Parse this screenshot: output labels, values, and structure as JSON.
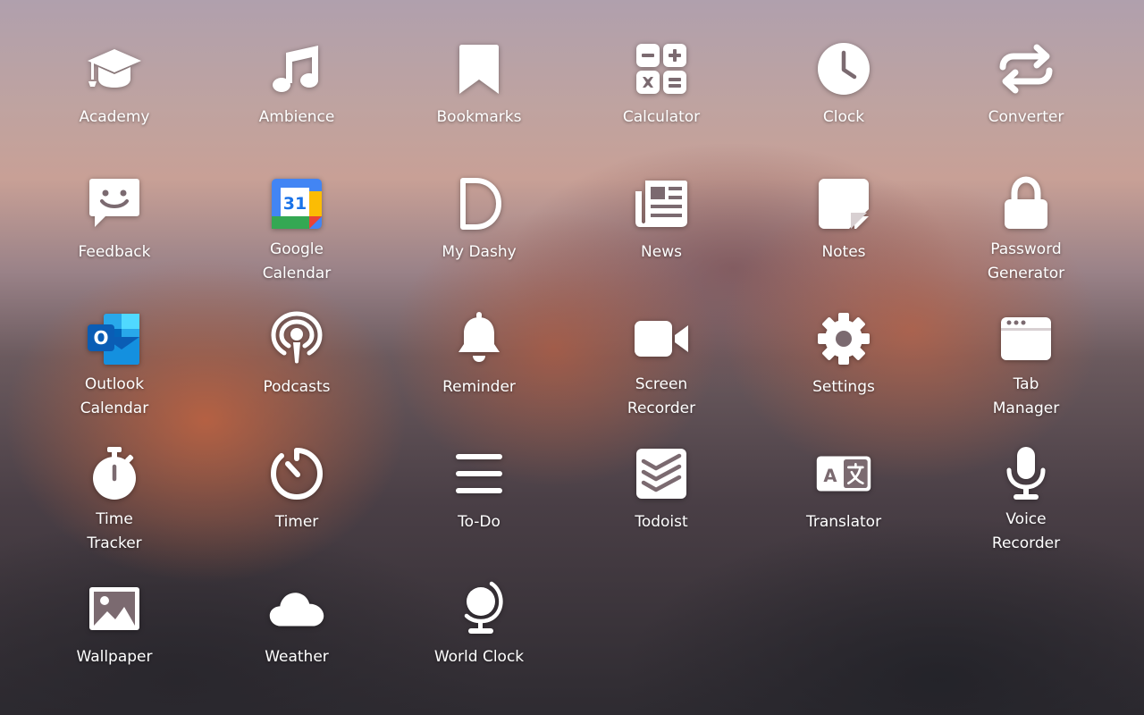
{
  "apps": [
    {
      "label": "Academy",
      "icon": "graduation-cap-icon"
    },
    {
      "label": "Ambience",
      "icon": "music-note-icon"
    },
    {
      "label": "Bookmarks",
      "icon": "bookmark-icon"
    },
    {
      "label": "Calculator",
      "icon": "calculator-icon"
    },
    {
      "label": "Clock",
      "icon": "clock-icon"
    },
    {
      "label": "Converter",
      "icon": "swap-arrows-icon"
    },
    {
      "label": "Feedback",
      "icon": "smiley-chat-icon"
    },
    {
      "label": "Google\nCalendar",
      "icon": "google-calendar-icon",
      "badge_text": "31"
    },
    {
      "label": "My Dashy",
      "icon": "dashy-logo-icon"
    },
    {
      "label": "News",
      "icon": "newspaper-icon"
    },
    {
      "label": "Notes",
      "icon": "sticky-note-icon"
    },
    {
      "label": "Password\nGenerator",
      "icon": "padlock-icon"
    },
    {
      "label": "Outlook\nCalendar",
      "icon": "outlook-icon",
      "badge_text": "O"
    },
    {
      "label": "Podcasts",
      "icon": "podcast-icon"
    },
    {
      "label": "Reminder",
      "icon": "bell-icon"
    },
    {
      "label": "Screen\nRecorder",
      "icon": "video-camera-icon"
    },
    {
      "label": "Settings",
      "icon": "gear-icon"
    },
    {
      "label": "Tab\nManager",
      "icon": "browser-window-icon"
    },
    {
      "label": "Time\nTracker",
      "icon": "stopwatch-icon"
    },
    {
      "label": "Timer",
      "icon": "timer-icon"
    },
    {
      "label": "To-Do",
      "icon": "list-lines-icon"
    },
    {
      "label": "Todoist",
      "icon": "todoist-icon"
    },
    {
      "label": "Translator",
      "icon": "translate-icon"
    },
    {
      "label": "Voice\nRecorder",
      "icon": "microphone-icon"
    },
    {
      "label": "Wallpaper",
      "icon": "image-icon"
    },
    {
      "label": "Weather",
      "icon": "cloud-icon"
    },
    {
      "label": "World Clock",
      "icon": "globe-icon"
    }
  ],
  "colors": {
    "icon": "#ffffff",
    "label": "#ffffff",
    "google_blue": "#4285f4",
    "google_red": "#ea4335",
    "google_yellow": "#fbbc04",
    "google_green": "#34a853",
    "outlook_dark": "#0a5db5",
    "outlook_light": "#28a8ea"
  }
}
